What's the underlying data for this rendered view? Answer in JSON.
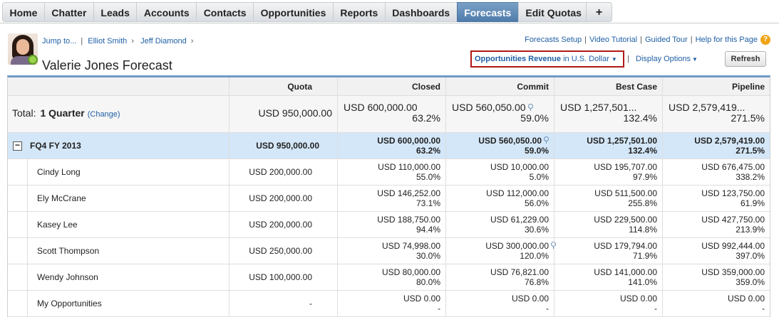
{
  "tabs": [
    "Home",
    "Chatter",
    "Leads",
    "Accounts",
    "Contacts",
    "Opportunities",
    "Reports",
    "Dashboards",
    "Forecasts",
    "Edit Quotas",
    "+"
  ],
  "active_tab": "Forecasts",
  "breadcrumb": {
    "jump": "Jump to...",
    "sep": "|",
    "items": [
      "Elliot Smith",
      "Jeff Diamond"
    ],
    "arrow": "›"
  },
  "page_title": "Valerie Jones Forecast",
  "top_links": [
    "Forecasts Setup",
    "Video Tutorial",
    "Guided Tour",
    "Help for this Page"
  ],
  "pipe": "|",
  "help_icon_glyph": "?",
  "forecast_type": {
    "bold": "Opportunities Revenue",
    "normal": " in U.S. Dollar",
    "caret": "▼"
  },
  "display_options": "Display Options",
  "display_caret": "▼",
  "refresh_label": "Refresh",
  "columns": [
    "",
    "Quota",
    "Closed",
    "Commit",
    "Best Case",
    "Pipeline"
  ],
  "total": {
    "label": "Total:",
    "period": "1 Quarter",
    "change": "(Change)",
    "quota": "USD 950,000.00",
    "closed": [
      "USD 600,000.00",
      "63.2%"
    ],
    "commit": [
      "USD 560,050.00",
      "59.0%"
    ],
    "best_case": [
      "USD 1,257,501...",
      "132.4%"
    ],
    "pipeline": [
      "USD 2,579,419...",
      "271.5%"
    ]
  },
  "period_row": {
    "toggle": "−",
    "label": "FQ4 FY 2013",
    "quota": "USD 950,000.00",
    "closed": [
      "USD 600,000.00",
      "63.2%"
    ],
    "commit": [
      "USD 560,050.00",
      "59.0%"
    ],
    "best_case": [
      "USD 1,257,501.00",
      "132.4%"
    ],
    "pipeline": [
      "USD 2,579,419.00",
      "271.5%"
    ]
  },
  "people": [
    {
      "name": "Cindy Long",
      "quota": "USD 200,000.00",
      "closed": [
        "USD 110,000.00",
        "55.0%"
      ],
      "commit": [
        "USD 10,000.00",
        "5.0%"
      ],
      "best_case": [
        "USD 195,707.00",
        "97.9%"
      ],
      "pipeline": [
        "USD 676,475.00",
        "338.2%"
      ]
    },
    {
      "name": "Ely McCrane",
      "quota": "USD 200,000.00",
      "closed": [
        "USD 146,252.00",
        "73.1%"
      ],
      "commit": [
        "USD 112,000.00",
        "56.0%"
      ],
      "best_case": [
        "USD 511,500.00",
        "255.8%"
      ],
      "pipeline": [
        "USD 123,750.00",
        "61.9%"
      ]
    },
    {
      "name": "Kasey Lee",
      "quota": "USD 200,000.00",
      "closed": [
        "USD 188,750.00",
        "94.4%"
      ],
      "commit": [
        "USD 61,229.00",
        "30.6%"
      ],
      "best_case": [
        "USD 229,500.00",
        "114.8%"
      ],
      "pipeline": [
        "USD 427,750.00",
        "213.9%"
      ]
    },
    {
      "name": "Scott Thompson",
      "quota": "USD 250,000.00",
      "closed": [
        "USD 74,998.00",
        "30.0%"
      ],
      "commit": [
        "USD 300,000.00",
        "120.0%"
      ],
      "best_case": [
        "USD 179,794.00",
        "71.9%"
      ],
      "pipeline": [
        "USD 992,444.00",
        "397.0%"
      ]
    },
    {
      "name": "Wendy Johnson",
      "quota": "USD 100,000.00",
      "closed": [
        "USD 80,000.00",
        "80.0%"
      ],
      "commit": [
        "USD 76,821.00",
        "76.8%"
      ],
      "best_case": [
        "USD 141,000.00",
        "141.0%"
      ],
      "pipeline": [
        "USD 359,000.00",
        "359.0%"
      ]
    },
    {
      "name": "My Opportunities",
      "quota": "-",
      "closed": [
        "USD 0.00",
        "-"
      ],
      "commit": [
        "USD 0.00",
        "-"
      ],
      "best_case": [
        "USD 0.00",
        "-"
      ],
      "pipeline": [
        "USD 0.00",
        "-"
      ]
    }
  ],
  "colors": {
    "active_tab": "#5a86b3",
    "period_row": "#d4e7f8",
    "grid_border": "#6d99c6",
    "link": "#1f5fa5",
    "picker_border": "#b21818"
  }
}
